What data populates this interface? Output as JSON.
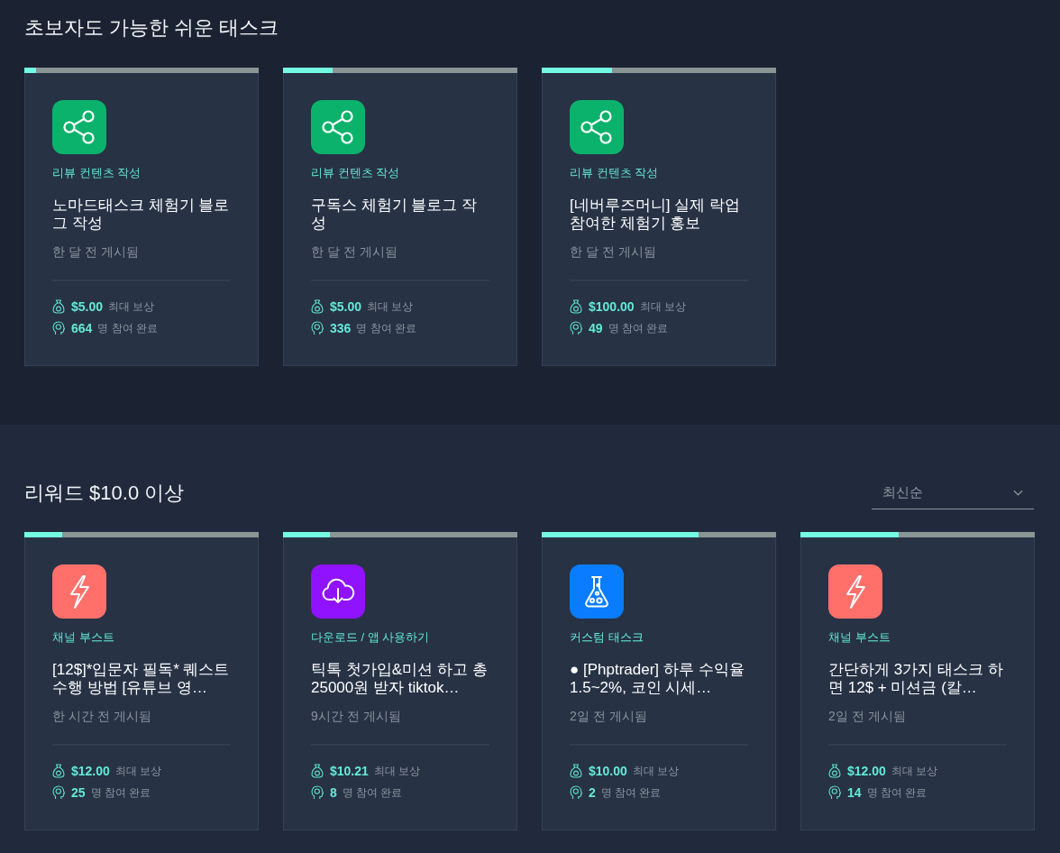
{
  "sections": [
    {
      "title": "초보자도 가능한 쉬운 태스크",
      "cards": [
        {
          "kind": "review",
          "color": "#0bb26b",
          "level": 0.05,
          "category": "리뷰 컨텐츠 작성",
          "title": "노마드태스크 체험기 블로그 작성",
          "posted": "한 달 전 게시됨",
          "reward": "$5.00",
          "reward_label": "최대 보상",
          "participants": "664",
          "participants_label": "명 참여 완료"
        },
        {
          "kind": "review",
          "color": "#0bb26b",
          "level": 0.21,
          "category": "리뷰 컨텐츠 작성",
          "title": "구독스 체험기 블로그 작성",
          "posted": "한 달 전 게시됨",
          "reward": "$5.00",
          "reward_label": "최대 보상",
          "participants": "336",
          "participants_label": "명 참여 완료"
        },
        {
          "kind": "review",
          "color": "#0bb26b",
          "level": 0.3,
          "category": "리뷰 컨텐츠 작성",
          "title": "[네버루즈머니] 실제 락업 참여한 체험기 홍보",
          "posted": "한 달 전 게시됨",
          "reward": "$100.00",
          "reward_label": "최대 보상",
          "participants": "49",
          "participants_label": "명 참여 완료"
        }
      ]
    },
    {
      "title": "리워드 $10.0 이상",
      "sort": {
        "value": "최신순"
      },
      "cards": [
        {
          "kind": "boost",
          "color": "#ff706b",
          "level": 0.16,
          "category": "채널 부스트",
          "title": "[12$]*입문자 필독* 퀘스트 수행 방법 [유튜브 영…",
          "posted": "한 시간 전 게시됨",
          "reward": "$12.00",
          "reward_label": "최대 보상",
          "participants": "25",
          "participants_label": "명 참여 완료"
        },
        {
          "kind": "download",
          "color": "#9012fe",
          "level": 0.2,
          "category": "다운로드 / 앱 사용하기",
          "title": "틱톡 첫가입&미션 하고 총 25000원 받자 tiktok…",
          "posted": "9시간 전 게시됨",
          "reward": "$10.21",
          "reward_label": "최대 보상",
          "participants": "8",
          "participants_label": "명 참여 완료"
        },
        {
          "kind": "custom",
          "color": "#0a7cff",
          "level": 0.67,
          "category": "커스텀 태스크",
          "title": "● [Phptrader] 하루 수익율 1.5~2%, 코인 시세…",
          "posted": "2일 전 게시됨",
          "reward": "$10.00",
          "reward_label": "최대 보상",
          "participants": "2",
          "participants_label": "명 참여 완료"
        },
        {
          "kind": "boost",
          "color": "#ff706b",
          "level": 0.42,
          "category": "채널 부스트",
          "title": "간단하게 3가지 태스크 하면 12$ + 미션금 (칼…",
          "posted": "2일 전 게시됨",
          "reward": "$12.00",
          "reward_label": "최대 보상",
          "participants": "14",
          "participants_label": "명 참여 완료"
        }
      ]
    }
  ]
}
